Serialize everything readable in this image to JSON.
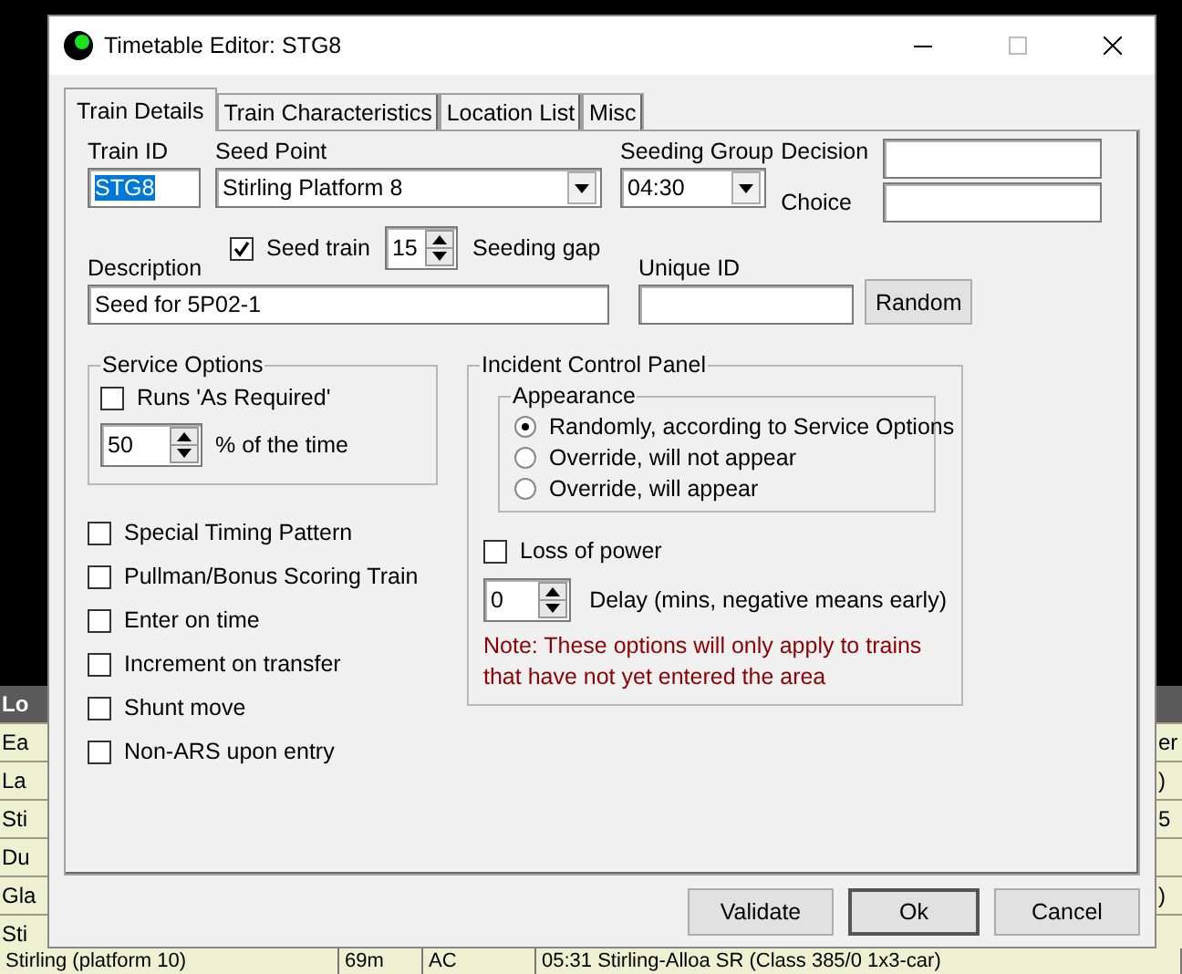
{
  "window": {
    "title": "Timetable Editor: STG8"
  },
  "tabs": [
    {
      "label": "Train Details",
      "selected": true
    },
    {
      "label": "Train Characteristics",
      "selected": false
    },
    {
      "label": "Location List",
      "selected": false
    },
    {
      "label": "Misc",
      "selected": false
    }
  ],
  "train_id": {
    "label": "Train ID",
    "value": "STG8",
    "highlighted": true
  },
  "seed_point": {
    "label": "Seed Point",
    "value": "Stirling Platform 8"
  },
  "seeding_group": {
    "label": "Seeding Group",
    "value": "04:30"
  },
  "decision": {
    "label": "Decision"
  },
  "choice": {
    "label": "Choice"
  },
  "seed_train": {
    "label": "Seed train",
    "checked": true
  },
  "seeding_gap": {
    "value": "15",
    "label": "Seeding gap"
  },
  "description": {
    "label": "Description",
    "value": "Seed for 5P02-1"
  },
  "unique_id": {
    "label": "Unique ID"
  },
  "random_button": "Random",
  "service_options": {
    "title": "Service Options",
    "runs_as_required": {
      "label": "Runs 'As Required'",
      "checked": false
    },
    "percent": {
      "value": "50",
      "label": "% of the time"
    }
  },
  "options": [
    {
      "label": "Special Timing Pattern",
      "checked": false
    },
    {
      "label": "Pullman/Bonus Scoring Train",
      "checked": false
    },
    {
      "label": "Enter on time",
      "checked": false
    },
    {
      "label": "Increment on transfer",
      "checked": false
    },
    {
      "label": "Shunt move",
      "checked": false
    },
    {
      "label": "Non-ARS upon entry",
      "checked": false
    }
  ],
  "incident_panel": {
    "title": "Incident Control Panel",
    "appearance": {
      "title": "Appearance",
      "choices": [
        {
          "label": "Randomly, according to Service Options",
          "selected": true
        },
        {
          "label": "Override, will not appear",
          "selected": false
        },
        {
          "label": "Override, will appear",
          "selected": false
        }
      ]
    },
    "loss_of_power": {
      "label": "Loss of power",
      "checked": false
    },
    "delay": {
      "value": "0",
      "label": "Delay (mins, negative means early)"
    },
    "note": "Note: These options will only apply to trains that have not yet entered the area"
  },
  "buttons": [
    {
      "label": "Validate",
      "default": false
    },
    {
      "label": "Ok",
      "default": true
    },
    {
      "label": "Cancel",
      "default": false
    }
  ],
  "background_table": {
    "header": "Lo",
    "rows": [
      {
        "column_1": "Ea",
        "column_last": "er"
      },
      {
        "column_1": "La",
        "column_last": ")"
      },
      {
        "column_1": "Sti",
        "column_last": "5"
      },
      {
        "column_1": "Du"
      },
      {
        "column_1": "Gla",
        "column_last": ")"
      },
      {
        "column_1": "Sti"
      }
    ],
    "bottom_row": {
      "column_1": "Stirling (platform 10)",
      "column_2": "69m",
      "column_3": "AC",
      "column_4": "05:31 Stirling-Alloa SR (Class 385/0 1x3-car)"
    }
  }
}
